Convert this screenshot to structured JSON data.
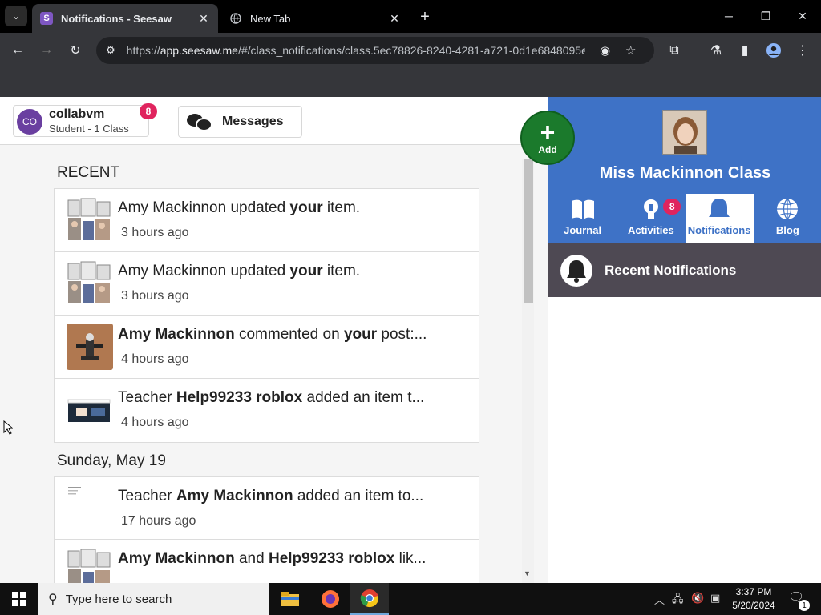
{
  "browser": {
    "tabs": [
      {
        "title": "Notifications - Seesaw",
        "favicon": "S",
        "active": true
      },
      {
        "title": "New Tab",
        "favicon": "globe-icon",
        "active": false
      }
    ],
    "url_prefix": "https://",
    "url_host": "app.seesaw.me",
    "url_path": "/#/class_notifications/class.5ec78826-8240-4281-a721-0d1e6848095e"
  },
  "account": {
    "initials": "CO",
    "name": "collabvm",
    "subtitle": "Student - 1 Class",
    "badge": "8"
  },
  "messages_label": "Messages",
  "add_label": "Add",
  "feed": {
    "recent_heading": "RECENT",
    "recent": [
      {
        "actor": "Amy Mackinnon",
        "actor_bold": false,
        "middle": " updated ",
        "obj": "your",
        "tail": " item.",
        "time": "3 hours ago",
        "thumb": "collage"
      },
      {
        "actor": "Amy Mackinnon",
        "actor_bold": false,
        "middle": " updated ",
        "obj": "your",
        "tail": " item.",
        "time": "3 hours ago",
        "thumb": "collage"
      },
      {
        "actor": "Amy Mackinnon",
        "actor_bold": true,
        "middle": " commented on ",
        "obj": "your",
        "tail": " post:...",
        "time": "4 hours ago",
        "thumb": "figure"
      },
      {
        "prefix": "Teacher ",
        "actor": "Help99233 roblox",
        "actor_bold": true,
        "middle": " added an item t...",
        "obj": "",
        "tail": "",
        "time": "4 hours ago",
        "thumb": "screen"
      }
    ],
    "day_heading": "Sunday, May 19",
    "day": [
      {
        "prefix": "Teacher ",
        "actor": "Amy Mackinnon",
        "actor_bold": true,
        "middle": " added an item to...",
        "obj": "",
        "tail": "",
        "time": "17 hours ago",
        "thumb": "doc"
      },
      {
        "actor": "Amy Mackinnon",
        "actor_bold": true,
        "middle": " and ",
        "obj": "Help99233 roblox",
        "tail": " lik...",
        "time": "",
        "thumb": "collage"
      }
    ]
  },
  "class_panel": {
    "name": "Miss Mackinnon Class",
    "tabs": [
      {
        "label": "Journal",
        "icon": "book-icon",
        "active": false
      },
      {
        "label": "Activities",
        "icon": "lightbulb-icon",
        "active": false,
        "badge": "8"
      },
      {
        "label": "Notifications",
        "icon": "bell-icon",
        "active": true
      },
      {
        "label": "Blog",
        "icon": "globe-icon",
        "active": false
      }
    ],
    "recent_label": "Recent Notifications"
  },
  "taskbar": {
    "search_placeholder": "Type here to search",
    "time": "3:37 PM",
    "date": "5/20/2024",
    "notification_count": "1"
  },
  "colors": {
    "class_blue": "#3e72c6",
    "add_green": "#1b7a2c",
    "badge_pink": "#e0245e",
    "recent_bar": "#4e4953"
  }
}
